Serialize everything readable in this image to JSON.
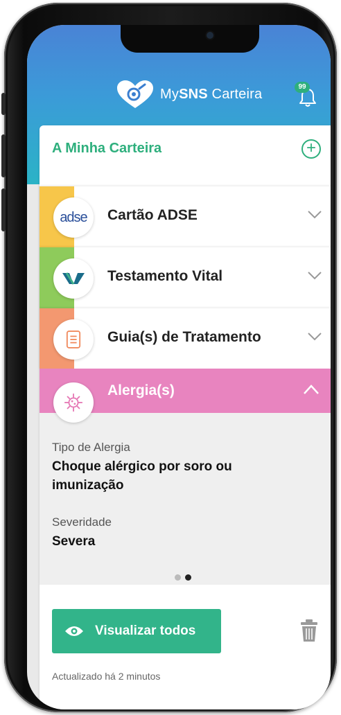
{
  "header": {
    "brand_prefix": "My",
    "brand_bold": "SNS",
    "brand_suffix": " Carteira",
    "notifications_count": "99"
  },
  "wallet": {
    "title": "A Minha Carteira",
    "add_icon": "plus-circle-icon",
    "items": [
      {
        "label": "Cartão ADSE",
        "logo_text": "adse",
        "icon": "adse-logo",
        "stripe_color": "#f7c64a"
      },
      {
        "label": "Testamento Vital",
        "icon": "testamento-vital-logo",
        "stripe_color": "#8ecb5b"
      },
      {
        "label": "Guia(s) de Tratamento",
        "icon": "document-icon",
        "stripe_color": "#f39870"
      }
    ],
    "allergy": {
      "label": "Alergia(s)",
      "icon": "virus-icon",
      "color": "#e884bf",
      "type_label": "Tipo de Alergia",
      "type_value": "Choque alérgico por soro ou imunização",
      "severity_label": "Severidade",
      "severity_value": "Severa",
      "pager_total": 2,
      "pager_active": 2
    },
    "view_all_label": "Visualizar todos",
    "updated_text": "Actualizado há 2 minutos"
  },
  "colors": {
    "brand_green": "#2eaf7d",
    "header_blue": "#4a83d6",
    "allergy_pink": "#e884bf"
  }
}
